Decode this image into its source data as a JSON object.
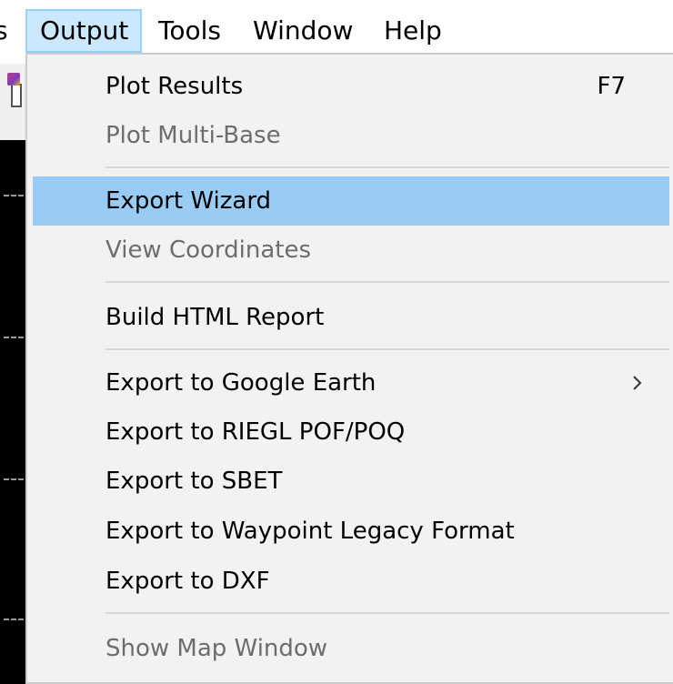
{
  "menubar": {
    "partial_item": "s",
    "items": [
      "Output",
      "Tools",
      "Window",
      "Help"
    ]
  },
  "menu": {
    "items": [
      {
        "label": "Plot Results",
        "shortcut": "F7",
        "enabled": true
      },
      {
        "label": "Plot Multi-Base",
        "enabled": false
      },
      {
        "label": "Export Wizard",
        "enabled": true,
        "highlighted": true
      },
      {
        "label": "View Coordinates",
        "enabled": false
      },
      {
        "label": "Build HTML Report",
        "enabled": true
      },
      {
        "label": "Export to Google Earth",
        "enabled": true,
        "submenu": true
      },
      {
        "label": "Export to RIEGL POF/POQ",
        "enabled": true
      },
      {
        "label": "Export to SBET",
        "enabled": true
      },
      {
        "label": "Export to Waypoint Legacy Format",
        "enabled": true
      },
      {
        "label": "Export to DXF",
        "enabled": true
      },
      {
        "label": "Show Map Window",
        "enabled": false
      }
    ]
  },
  "colors": {
    "highlight": "#99ccf5",
    "active_menubar_bg": "#cce8ff",
    "disabled_text": "#6d6d6d",
    "menu_bg": "#f2f2f2"
  },
  "icons": {
    "submenu": "chevron-right-icon",
    "toolbar": "toolbar-icon"
  }
}
